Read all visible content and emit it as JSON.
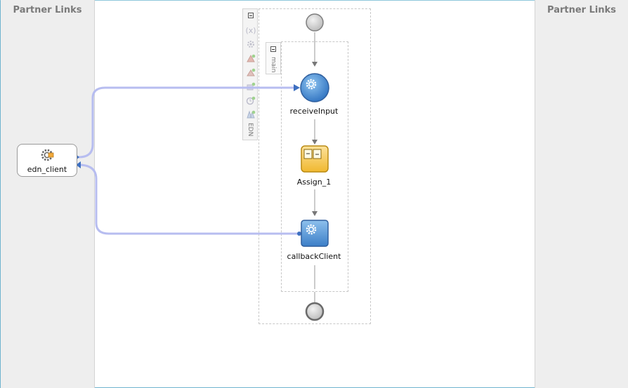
{
  "left_lane": {
    "title": "Partner Links"
  },
  "right_lane": {
    "title": "Partner Links"
  },
  "partner_link": {
    "label": "edn_client"
  },
  "process": {
    "scope_tab_label": "main",
    "toolbar_footer_label": "EDN",
    "activities": [
      {
        "label": "receiveInput",
        "kind": "receive"
      },
      {
        "label": "Assign_1",
        "kind": "assign"
      },
      {
        "label": "callbackClient",
        "kind": "invoke"
      }
    ]
  },
  "colors": {
    "link_line": "#b7bdf0",
    "arrow": "#3d6fc0",
    "receive_fill": "#4a8fd8",
    "invoke_fill": "#5a9ad6",
    "assign_fill": "#f7cf55",
    "lane_bg": "#eeeeee"
  },
  "icons": [
    "gear-icon",
    "variable-icon",
    "correlation-icon",
    "add-icon",
    "timer-icon",
    "collapse-icon"
  ]
}
